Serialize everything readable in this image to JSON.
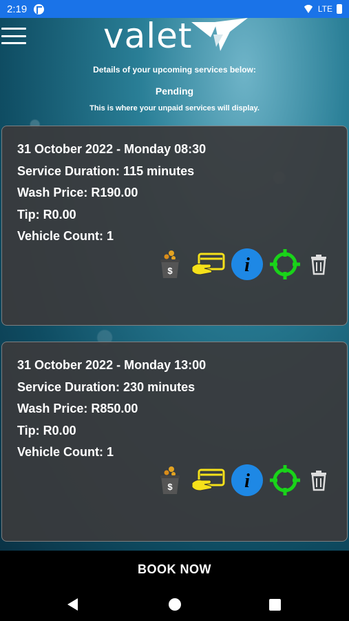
{
  "status_bar": {
    "time": "2:19",
    "network": "LTE"
  },
  "header": {
    "logo_text": "valet",
    "menu_icon": "hamburger-menu-icon"
  },
  "intro": {
    "subtitle": "Details of your upcoming services below:",
    "section_title": "Pending",
    "section_note": "This is where your unpaid services will display."
  },
  "bookings": [
    {
      "date_line": "31 October 2022 - Monday 08:30",
      "duration_line": "Service Duration: 115 minutes",
      "price_line": "Wash Price: R190.00",
      "tip_line": "Tip: R0.00",
      "vehicle_line": "Vehicle Count: 1"
    },
    {
      "date_line": "31 October 2022 - Monday 13:00",
      "duration_line": "Service Duration: 230 minutes",
      "price_line": "Wash Price: R850.00",
      "tip_line": "Tip: R0.00",
      "vehicle_line": "Vehicle Count: 1"
    }
  ],
  "actions": {
    "icons": [
      "tip-jar-icon",
      "card-payment-icon",
      "info-icon",
      "locate-icon",
      "trash-icon"
    ]
  },
  "footer": {
    "book_label": "BOOK NOW"
  },
  "colors": {
    "status_bar": "#1a73e8",
    "card_bg": "#3a3a3c",
    "pay_icon": "#f5e11a",
    "info_icon": "#1e88e5",
    "locate_icon": "#19d319"
  }
}
